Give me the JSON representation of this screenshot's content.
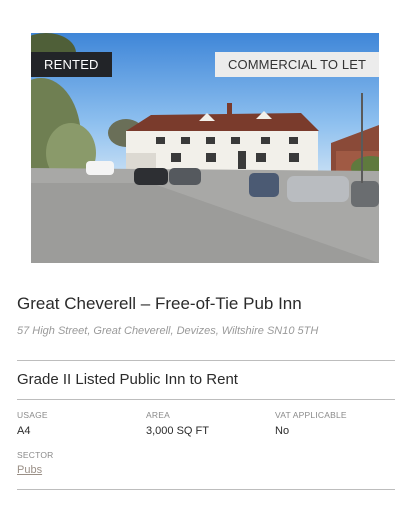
{
  "listing": {
    "image": {
      "description_icon": "photo-image"
    },
    "status_badge": "RENTED",
    "type_badge": "COMMERCIAL TO LET",
    "title": "Great Cheverell – Free-of-Tie Pub Inn",
    "address": "57 High Street, Great Cheverell, Devizes, Wiltshire SN10 5TH",
    "subtitle": "Grade II Listed Public Inn to Rent",
    "fields": {
      "usage": {
        "label": "USAGE",
        "value": "A4"
      },
      "area": {
        "label": "AREA",
        "value": "3,000 SQ FT"
      },
      "vat": {
        "label": "VAT APPLICABLE",
        "value": "No"
      },
      "sector": {
        "label": "SECTOR",
        "value": "Pubs"
      }
    }
  }
}
